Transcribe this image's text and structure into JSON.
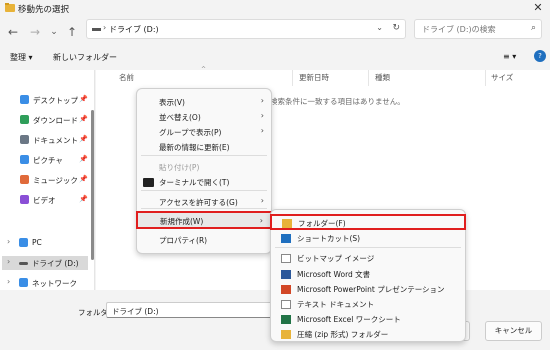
{
  "window": {
    "title": "移動先の選択",
    "close": "✕"
  },
  "nav": {
    "back": "←",
    "forward": "→",
    "down": "⌄",
    "up": "↑"
  },
  "address": {
    "separator": "›",
    "path": "ドライブ (D:)",
    "dropdown": "⌄",
    "refresh": "↻"
  },
  "search": {
    "placeholder": "ドライブ (D:)の検索",
    "icon": "⌕"
  },
  "toolbar": {
    "organize": "整理 ▾",
    "new_folder": "新しいフォルダー",
    "view": "≡ ▾",
    "help": "?"
  },
  "columns": [
    "名前",
    "更新日時",
    "種類",
    "サイズ"
  ],
  "empty_message": "検索条件に一致する項目はありません。",
  "sidebar": {
    "items": [
      {
        "label": "デスクトップ",
        "pinned": true,
        "icon": "desktop-icon",
        "color": "#3a8ee6"
      },
      {
        "label": "ダウンロード",
        "pinned": true,
        "icon": "download-icon",
        "color": "#2f9e5a"
      },
      {
        "label": "ドキュメント",
        "pinned": true,
        "icon": "document-icon",
        "color": "#6b7785"
      },
      {
        "label": "ピクチャ",
        "pinned": true,
        "icon": "picture-icon",
        "color": "#3a8ee6"
      },
      {
        "label": "ミュージック",
        "pinned": true,
        "icon": "music-icon",
        "color": "#e06a3a"
      },
      {
        "label": "ビデオ",
        "pinned": true,
        "icon": "video-icon",
        "color": "#8a4fd6"
      }
    ],
    "tree": [
      {
        "label": "PC",
        "icon": "pc-icon",
        "expander": "›"
      },
      {
        "label": "ドライブ (D:)",
        "icon": "drive-icon",
        "expander": "›",
        "selected": true
      },
      {
        "label": "ネットワーク",
        "icon": "network-icon",
        "expander": "›"
      }
    ],
    "pin_glyph": "📌"
  },
  "context_menu": {
    "items": [
      {
        "label": "表示(V)",
        "arrow": true
      },
      {
        "label": "並べ替え(O)",
        "arrow": true
      },
      {
        "label": "グループで表示(P)",
        "arrow": true
      },
      {
        "label": "最新の情報に更新(E)"
      },
      {
        "label": "貼り付け(P)",
        "disabled": true
      },
      {
        "label": "ターミナルで開く(T)",
        "icon": "terminal-icon"
      },
      {
        "label": "アクセスを許可する(G)",
        "arrow": true
      },
      {
        "label": "新規作成(W)",
        "arrow": true,
        "highlighted": true
      },
      {
        "label": "プロパティ(R)"
      }
    ],
    "arrow_glyph": "›"
  },
  "submenu": {
    "items": [
      {
        "label": "フォルダー(F)",
        "icon": "folder-icon",
        "highlighted": true
      },
      {
        "label": "ショートカット(S)",
        "icon": "shortcut-icon"
      },
      {
        "label": "ビットマップ イメージ",
        "icon": "bitmap-icon"
      },
      {
        "label": "Microsoft Word 文書",
        "icon": "word-icon"
      },
      {
        "label": "Microsoft PowerPoint プレゼンテーション",
        "icon": "powerpoint-icon"
      },
      {
        "label": "テキスト ドキュメント",
        "icon": "text-icon"
      },
      {
        "label": "Microsoft Excel ワークシート",
        "icon": "excel-icon"
      },
      {
        "label": "圧縮 (zip 形式) フォルダー",
        "icon": "zip-icon"
      }
    ]
  },
  "footer": {
    "folder_label": "フォルダー:",
    "folder_value": "ドライブ (D:)",
    "ok_label": "",
    "cancel_label": "キャンセル"
  },
  "colors": {
    "highlight_border": "#e01e1e",
    "accent": "#0067c0"
  }
}
